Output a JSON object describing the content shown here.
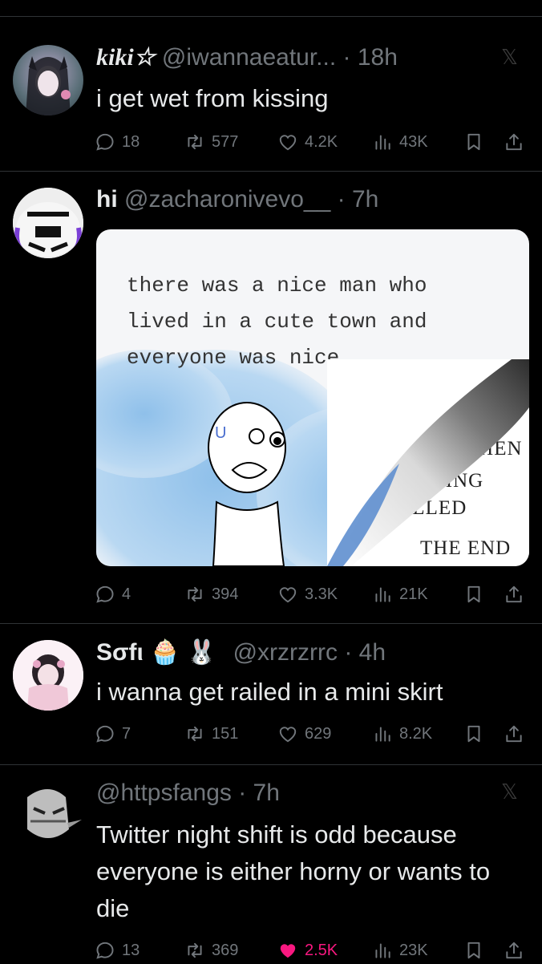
{
  "tweets": [
    {
      "name": "kiki☆",
      "handle": "@iwannaeatur...",
      "time": "· 18h",
      "text": "i get wet from kissing",
      "stats": {
        "replies": "18",
        "retweets": "577",
        "likes": "4.2K",
        "views": "43K"
      }
    },
    {
      "name": "hi",
      "handle": "@zacharonivevo__",
      "time": "· 7h",
      "image": {
        "page_text": "there was a nice man who\nlived in a cute town and\neveryone was nice",
        "curl_line1": "ND THEN",
        "curl_line2": "UCKING",
        "curl_line3": "KILLED",
        "curl_line4": "THE END"
      },
      "stats": {
        "replies": "4",
        "retweets": "394",
        "likes": "3.3K",
        "views": "21K"
      }
    },
    {
      "name": "Sσfι 🧁 🐰",
      "handle": "@xrzrzrrc",
      "time": "· 4h",
      "text": "i wanna get railed in a mini skirt",
      "stats": {
        "replies": "7",
        "retweets": "151",
        "likes": "629",
        "views": "8.2K"
      }
    },
    {
      "name": "",
      "handle": "@httpsfangs",
      "time": "· 7h",
      "text": "Twitter night shift is odd because everyone is either horny or wants to die",
      "stats": {
        "replies": "13",
        "retweets": "369",
        "likes": "2.5K",
        "views": "23K"
      },
      "liked": true
    }
  ],
  "colors": {
    "like_active": "#f91880",
    "muted": "#71767b",
    "text": "#e7e9ea"
  },
  "icons": [
    "reply-icon",
    "retweet-icon",
    "like-icon",
    "views-icon",
    "bookmark-icon",
    "share-icon",
    "grok-icon"
  ]
}
